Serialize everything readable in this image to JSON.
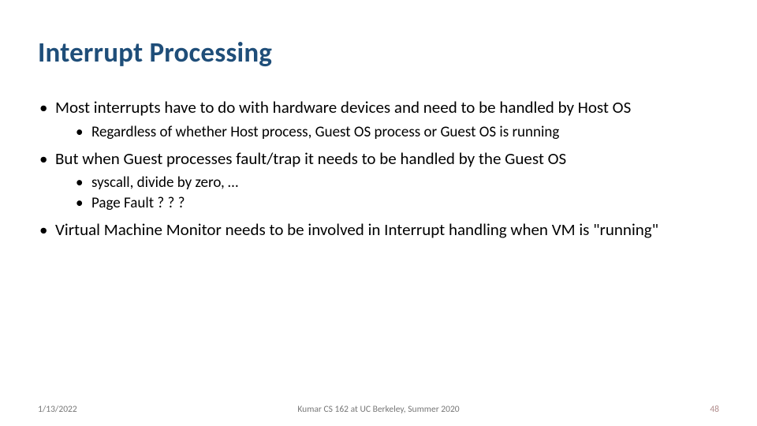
{
  "title": "Interrupt Processing",
  "bullets": {
    "b1": "Most interrupts have to do with hardware devices and need to be handled by Host OS",
    "b1a": "Regardless of whether Host process, Guest OS process or Guest OS is running",
    "b2": "But when Guest processes fault/trap it needs to be handled by the Guest OS",
    "b2a": "syscall, divide by zero, …",
    "b2b": "Page Fault ? ? ?",
    "b3": "Virtual Machine Monitor needs to be involved in Interrupt handling when VM is \"running\""
  },
  "footer": {
    "date": "1/13/2022",
    "center": "Kumar CS 162 at UC Berkeley, Summer 2020",
    "page": "48"
  }
}
